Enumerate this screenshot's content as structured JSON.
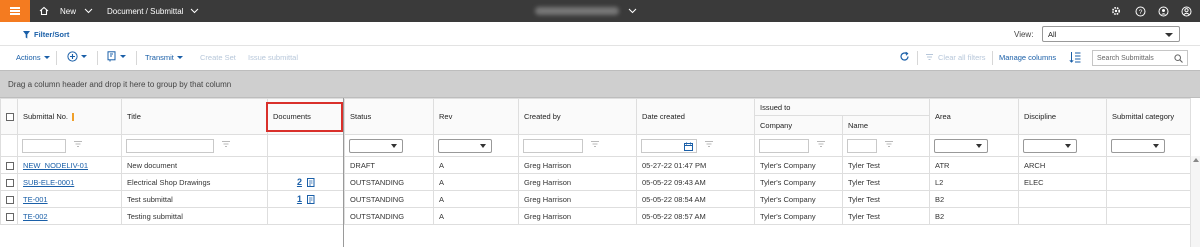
{
  "topbar": {
    "new_label": "New",
    "breadcrumb": "Document / Submittal"
  },
  "filterbar": {
    "filter_sort": "Filter/Sort",
    "view_label": "View:",
    "view_value": "All"
  },
  "toolbar": {
    "actions": "Actions",
    "transmit": "Transmit",
    "create_set": "Create Set",
    "issue_submittal": "Issue submittal",
    "clear_filters": "Clear all filters",
    "manage_columns": "Manage columns",
    "search_placeholder": "Search Submittals"
  },
  "groupbar": {
    "hint": "Drag a column header and drop it here to group by that column"
  },
  "grid": {
    "group_header": "Issued to",
    "columns": {
      "submittal_no": "Submittal No.",
      "title": "Title",
      "documents": "Documents",
      "status": "Status",
      "rev": "Rev",
      "created_by": "Created by",
      "date_created": "Date created",
      "company": "Company",
      "name": "Name",
      "area": "Area",
      "discipline": "Discipline",
      "submittal_category": "Submittal category"
    },
    "rows": [
      {
        "submittal_no": "NEW_NODELIV-01",
        "title": "New document",
        "documents": "",
        "status": "DRAFT",
        "rev": "A",
        "created_by": "Greg Harrison",
        "date_created": "05-27-22 01:47 PM",
        "company": "Tyler's Company",
        "name": "Tyler Test",
        "area": "ATR",
        "discipline": "ARCH",
        "submittal_category": ""
      },
      {
        "submittal_no": "SUB-ELE-0001",
        "title": "Electrical Shop Drawings",
        "documents": "2",
        "status": "OUTSTANDING",
        "rev": "A",
        "created_by": "Greg Harrison",
        "date_created": "05-05-22 09:43 AM",
        "company": "Tyler's Company",
        "name": "Tyler Test",
        "area": "L2",
        "discipline": "ELEC",
        "submittal_category": ""
      },
      {
        "submittal_no": "TE-001",
        "title": "Test submittal",
        "documents": "1",
        "status": "OUTSTANDING",
        "rev": "A",
        "created_by": "Greg Harrison",
        "date_created": "05-05-22 08:54 AM",
        "company": "Tyler's Company",
        "name": "Tyler Test",
        "area": "B2",
        "discipline": "",
        "submittal_category": ""
      },
      {
        "submittal_no": "TE-002",
        "title": "Testing submittal",
        "documents": "",
        "status": "OUTSTANDING",
        "rev": "A",
        "created_by": "Greg Harrison",
        "date_created": "05-05-22 08:57 AM",
        "company": "Tyler's Company",
        "name": "Tyler Test",
        "area": "B2",
        "discipline": "",
        "submittal_category": ""
      }
    ]
  },
  "icons": {
    "home": "home-icon",
    "settings": "gear-icon",
    "help": "help-icon",
    "account": "user-icon",
    "profile": "profile-icon",
    "refresh": "refresh-icon",
    "clear_filters": "filter-clear-icon",
    "column_settings": "column-settings-icon",
    "search": "search-icon",
    "document": "document-icon",
    "calendar": "calendar-icon"
  },
  "colors": {
    "accent": "#f47b20",
    "link": "#1a5fa8",
    "topbar": "#3a3a3a",
    "highlight": "#d9302b"
  }
}
